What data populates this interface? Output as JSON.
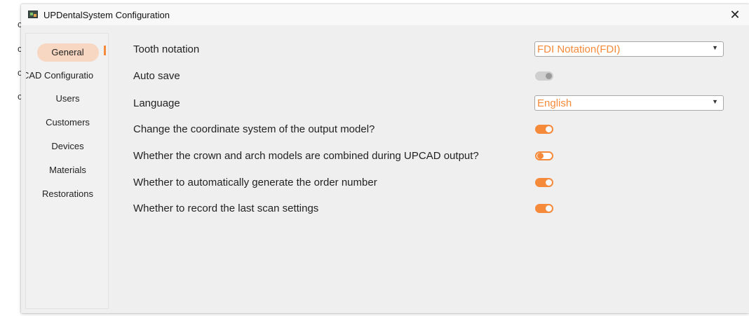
{
  "background_fragments": [
    "c",
    "c",
    "c",
    "c"
  ],
  "window": {
    "title": "UPDentalSystem Configuration",
    "close_symbol": "✕"
  },
  "sidebar": {
    "items": [
      {
        "label": "General",
        "active": true
      },
      {
        "label": "CAD Configuratio",
        "active": false
      },
      {
        "label": "Users",
        "active": false
      },
      {
        "label": "Customers",
        "active": false
      },
      {
        "label": "Devices",
        "active": false
      },
      {
        "label": "Materials",
        "active": false
      },
      {
        "label": "Restorations",
        "active": false
      }
    ]
  },
  "settings": {
    "tooth_notation": {
      "label": "Tooth notation",
      "value": "FDI Notation(FDI)"
    },
    "auto_save": {
      "label": "Auto save",
      "state": "off"
    },
    "language": {
      "label": "Language",
      "value": "English"
    },
    "coordinate_system": {
      "label": "Change the coordinate system of the output model?",
      "state": "on"
    },
    "combine_models": {
      "label": "Whether the crown and arch models are combined during UPCAD output?",
      "state": "off"
    },
    "auto_order_number": {
      "label": "Whether to automatically generate the order number",
      "state": "on"
    },
    "record_last_scan": {
      "label": "Whether to record the last scan settings",
      "state": "on"
    }
  },
  "icons": {
    "app": "app-window-icon",
    "dropdown": "chevron-down-icon"
  },
  "colors": {
    "accent": "#f58a3b",
    "active_nav_bg": "#f7d7c1",
    "window_bg": "#efefef",
    "toggle_off": "#cfcfcf"
  }
}
